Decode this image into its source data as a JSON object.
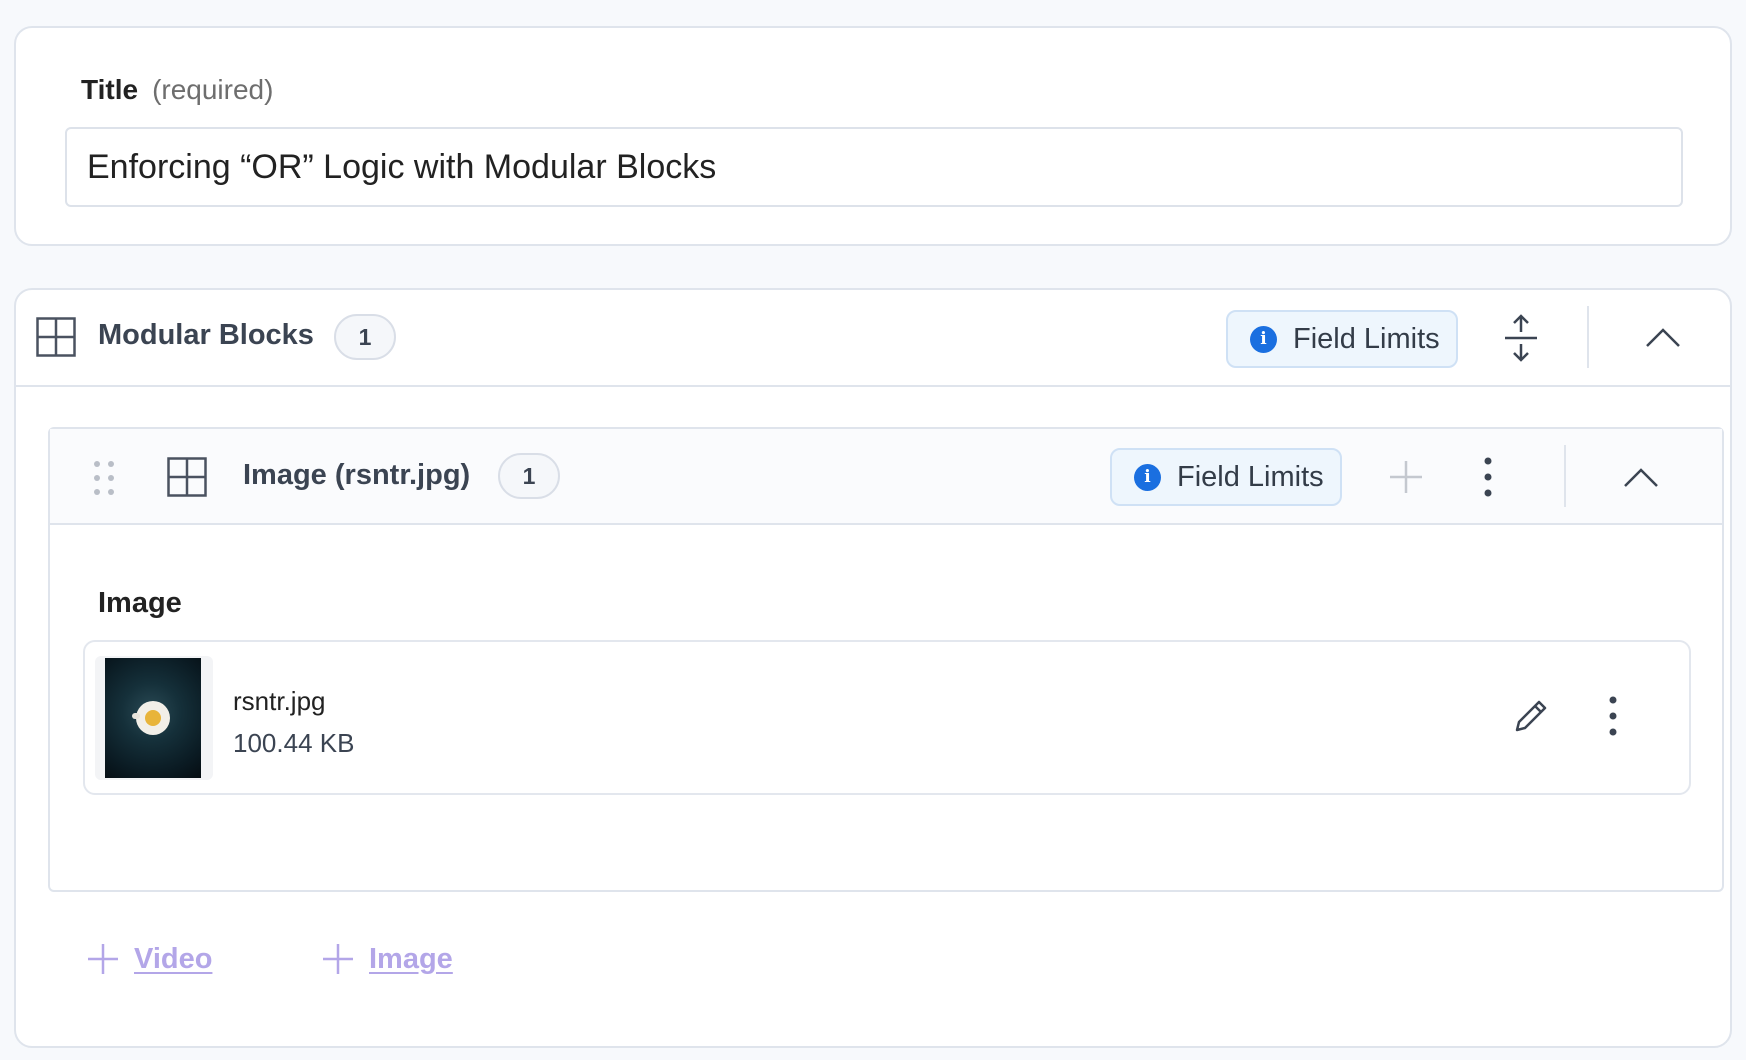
{
  "title_field": {
    "label": "Title",
    "required_hint": "(required)",
    "value": "Enforcing “OR” Logic with Modular Blocks"
  },
  "modular_blocks": {
    "title": "Modular Blocks",
    "count": "1",
    "field_limits_label": "Field Limits",
    "block": {
      "title": "Image (rsntr.jpg)",
      "count": "1",
      "field_limits_label": "Field Limits",
      "field_label": "Image",
      "asset": {
        "file_name": "rsntr.jpg",
        "file_size": "100.44 KB"
      }
    },
    "add_options": [
      "Video",
      "Image"
    ]
  },
  "icons": {
    "grid": "grid-icon",
    "info": "info-icon",
    "expand_collapse": "expand-collapse-icon",
    "chevron_up": "chevron-up-icon",
    "drag": "drag-handle-icon",
    "plus": "plus-icon",
    "kebab": "more-vertical-icon",
    "pencil": "pencil-icon"
  },
  "colors": {
    "info_blue": "#1a6fe0",
    "add_link_purple": "#b3a6e8",
    "border": "#dfe4ec"
  }
}
